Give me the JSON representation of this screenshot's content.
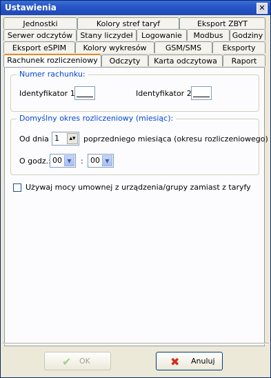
{
  "window": {
    "title": "Ustawienia",
    "close_label": "✕"
  },
  "tabs": {
    "row1": [
      "Jednostki",
      "Kolory stref taryf",
      "Eksport ZBYT"
    ],
    "row2": [
      "Serwer odczytów",
      "Stany liczydeł",
      "Logowanie",
      "Modbus",
      "Godziny"
    ],
    "row3": [
      "Eksport eSPIM",
      "Kolory wykresów",
      "GSM/SMS",
      "Eksporty"
    ],
    "row4": [
      "Rachunek rozliczeniowy",
      "Odczyty",
      "Karta odczytowa",
      "Raport"
    ],
    "active": "Rachunek rozliczeniowy"
  },
  "account_number": {
    "legend": "Numer rachunku:",
    "id1_label": "Identyfikator 1:",
    "id1_value": "",
    "id2_label": "Identyfikator 2:",
    "id2_value": ""
  },
  "billing_period": {
    "legend": "Domyślny okres rozliczeniowy (miesiąc):",
    "from_day_label": "Od dnia",
    "from_day_value": "1",
    "from_day_suffix": "poprzedniego miesiąca (okresu rozliczeniowego)",
    "hour_label": "O godz.:",
    "hour_value": "00",
    "minute_separator": ":",
    "minute_value": "00"
  },
  "use_contract_power": {
    "label": "Używaj mocy umownej z urządzenia/grupy zamiast z taryfy",
    "checked": false
  },
  "buttons": {
    "ok": "OK",
    "cancel": "Anuluj"
  }
}
